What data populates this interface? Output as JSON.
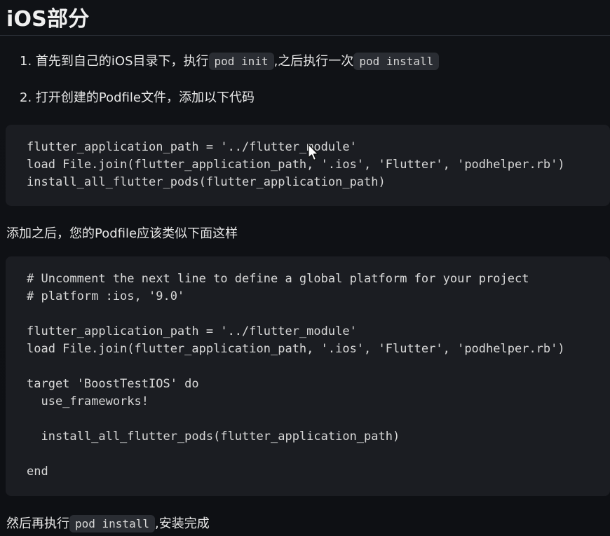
{
  "heading": "iOS部分",
  "steps": [
    {
      "number": "1.",
      "text_before": "首先到自己的iOS目录下，执行",
      "code_1": "pod init",
      "text_middle": ",之后执行一次",
      "code_2": "pod install"
    },
    {
      "number": "2.",
      "text": "打开创建的Podfile文件，添加以下代码"
    }
  ],
  "code_block_1": [
    "flutter_application_path = '../flutter_module'",
    "load File.join(flutter_application_path, '.ios', 'Flutter', 'podhelper.rb')",
    "install_all_flutter_pods(flutter_application_path)"
  ],
  "middle_paragraph": "添加之后，您的Podfile应该类似下面这样",
  "code_block_2": [
    "# Uncomment the next line to define a global platform for your project",
    "# platform :ios, '9.0'",
    "",
    "flutter_application_path = '../flutter_module'",
    "load File.join(flutter_application_path, '.ios', 'Flutter', 'podhelper.rb')",
    "",
    "target 'BoostTestIOS' do",
    "  use_frameworks!",
    "",
    "  install_all_flutter_pods(flutter_application_path)",
    "",
    "end"
  ],
  "final_paragraph": {
    "text_before": "然后再执行",
    "code": "pod install",
    "text_after": ",安装完成"
  },
  "colors": {
    "background": "#0f1115",
    "code_background": "#1b1d22",
    "inline_code_background": "#2a2d33",
    "text": "#e6e6e6"
  },
  "icons": [
    "mouse-cursor-icon"
  ]
}
